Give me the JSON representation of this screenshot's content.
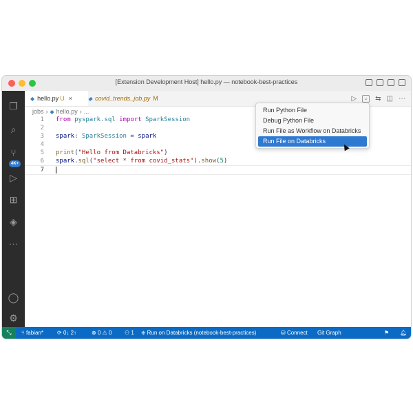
{
  "window": {
    "title": "[Extension Development Host] hello.py — notebook-best-practices"
  },
  "activity_bar": {
    "badge": "4K+"
  },
  "tabs": [
    {
      "name": "hello.py",
      "status": "U",
      "close": "×"
    },
    {
      "name": "covid_trends_job.py",
      "status": "M"
    }
  ],
  "breadcrumb": {
    "folder": "jobs",
    "file": "hello.py",
    "more": "..."
  },
  "code": {
    "line_numbers": [
      "1",
      "2",
      "3",
      "4",
      "5",
      "6",
      "7"
    ],
    "l1": {
      "kw1": "from",
      "mod": "pyspark.sql",
      "kw2": "import",
      "cls": "SparkSession"
    },
    "l3": {
      "var": "spark",
      "colon": ": ",
      "type": "SparkSession",
      "eq": " = ",
      "val": "spark"
    },
    "l5": {
      "fn": "print",
      "open": "(",
      "str": "\"Hello from Databricks\"",
      "close": ")"
    },
    "l6": {
      "obj": "spark",
      "dot1": ".",
      "fn1": "sql",
      "open": "(",
      "str": "\"select * from covid_stats\"",
      "mid": ").",
      "fn2": "show",
      "open2": "(",
      "num": "5",
      "close": ")"
    }
  },
  "run_menu": {
    "items": [
      "Run Python File",
      "Debug Python File",
      "Run File as Workflow on Databricks",
      "Run File on Databricks"
    ],
    "selected_index": 3
  },
  "status_bar": {
    "remote": "⤡",
    "branch": "fabian*",
    "sync": "0↓ 2↑",
    "problems": "⊗ 0 ⚠ 0",
    "ports": "1",
    "run_on": "Run on Databricks (notebook-best-practices)",
    "connect": "Connect",
    "git_graph": "Git Graph"
  },
  "colors": {
    "status_bar": "#0b6bc4",
    "activity_bar": "#2c2c2c",
    "menu_selected": "#2f7ad1",
    "badge": "#2f7ad1"
  }
}
